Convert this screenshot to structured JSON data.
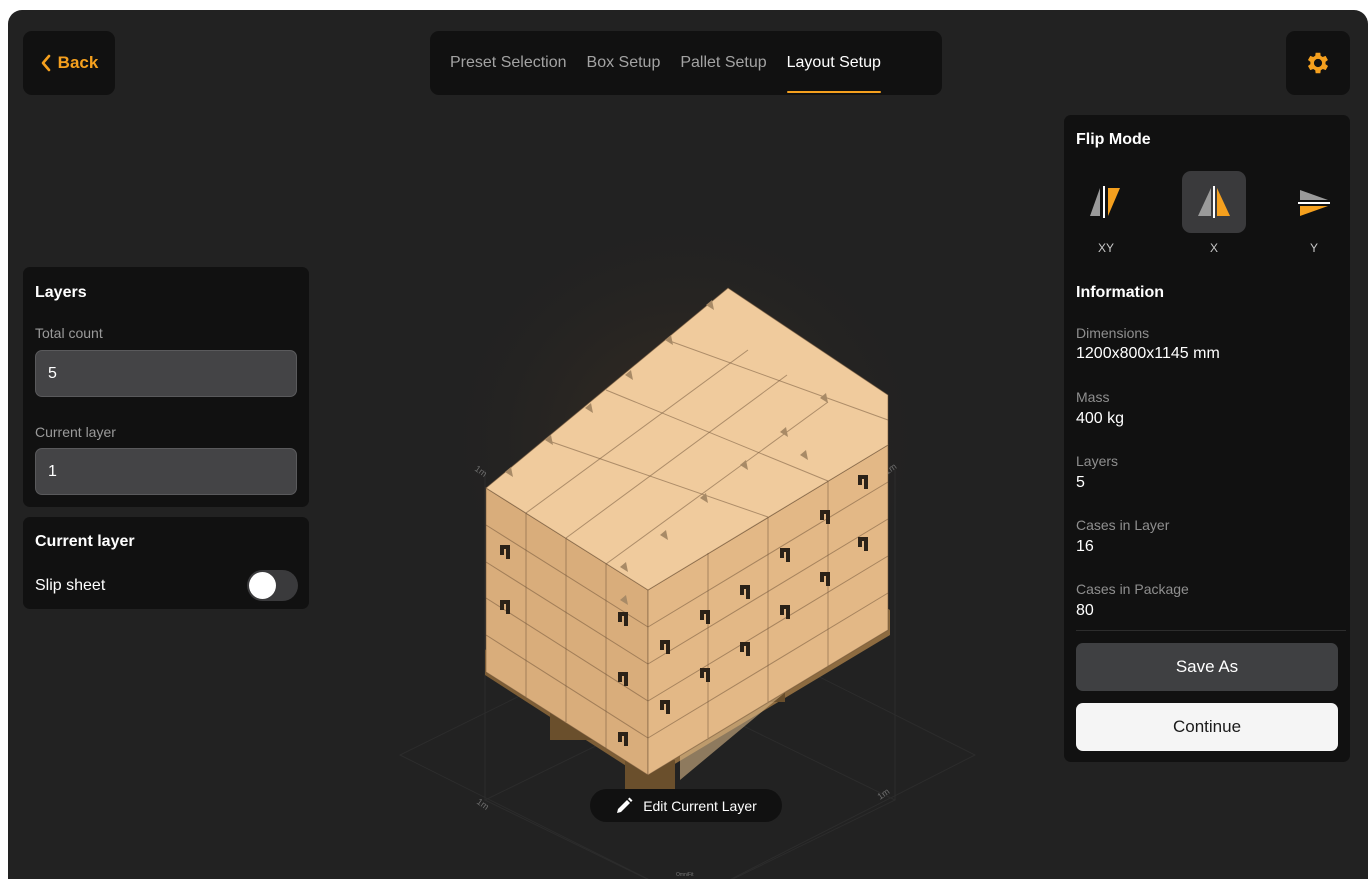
{
  "nav": {
    "back_label": "Back",
    "tabs": [
      {
        "label": "Preset Selection",
        "active": false
      },
      {
        "label": "Box Setup",
        "active": false
      },
      {
        "label": "Pallet Setup",
        "active": false
      },
      {
        "label": "Layout Setup",
        "active": true
      }
    ],
    "settings_icon": "gear-icon"
  },
  "layers_panel": {
    "title": "Layers",
    "total_count_label": "Total count",
    "total_count_value": "5",
    "current_layer_label": "Current layer",
    "current_layer_value": "1"
  },
  "current_layer_panel": {
    "title": "Current layer",
    "slip_sheet_label": "Slip sheet",
    "slip_sheet_on": false
  },
  "flip_mode": {
    "title": "Flip Mode",
    "options": [
      {
        "label": "XY",
        "icon": "flip-xy-icon",
        "selected": false
      },
      {
        "label": "X",
        "icon": "flip-x-icon",
        "selected": true
      },
      {
        "label": "Y",
        "icon": "flip-y-icon",
        "selected": false
      }
    ]
  },
  "information": {
    "title": "Information",
    "dimensions_label": "Dimensions",
    "dimensions_value": "1200x800x1145 mm",
    "mass_label": "Mass",
    "mass_value": "400 kg",
    "layers_label": "Layers",
    "layers_value": "5",
    "cases_in_layer_label": "Cases in Layer",
    "cases_in_layer_value": "16",
    "cases_in_package_label": "Cases in Package",
    "cases_in_package_value": "80"
  },
  "actions": {
    "save_as_label": "Save As",
    "continue_label": "Continue"
  },
  "viewport": {
    "edit_label": "Edit Current Layer",
    "grid_unit_label": "1m",
    "footer_mark": "OmniFit"
  },
  "colors": {
    "accent": "#f5a01e",
    "panel_bg": "#111111",
    "app_bg": "#222222",
    "box_top": "#efc898",
    "box_side": "#d6aa77"
  }
}
